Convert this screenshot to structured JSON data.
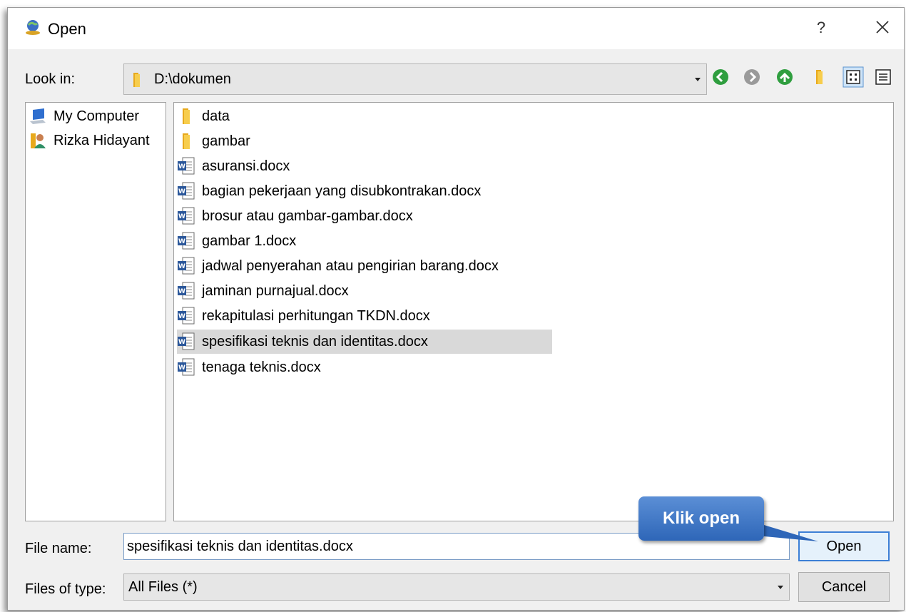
{
  "window": {
    "title": "Open",
    "help_label": "?"
  },
  "look_in": {
    "label": "Look in:",
    "path": "D:\\dokumen"
  },
  "toolbar": [
    "back-icon",
    "forward-icon",
    "up-icon",
    "new-folder-icon",
    "list-view-icon",
    "details-view-icon"
  ],
  "places": [
    {
      "label": "My Computer",
      "icon": "computer-icon"
    },
    {
      "label": "Rizka Hidayant",
      "icon": "user-folder-icon"
    }
  ],
  "files": [
    {
      "name": "data",
      "type": "folder"
    },
    {
      "name": "gambar",
      "type": "folder"
    },
    {
      "name": "asuransi.docx",
      "type": "docx"
    },
    {
      "name": "bagian pekerjaan yang disubkontrakan.docx",
      "type": "docx"
    },
    {
      "name": "brosur atau gambar-gambar.docx",
      "type": "docx"
    },
    {
      "name": "gambar 1.docx",
      "type": "docx"
    },
    {
      "name": "jadwal penyerahan atau pengirian barang.docx",
      "type": "docx"
    },
    {
      "name": "jaminan purnajual.docx",
      "type": "docx"
    },
    {
      "name": "rekapitulasi perhitungan TKDN.docx",
      "type": "docx"
    },
    {
      "name": "spesifikasi teknis dan identitas.docx",
      "type": "docx",
      "selected": true
    },
    {
      "name": "tenaga teknis.docx",
      "type": "docx"
    }
  ],
  "file_name": {
    "label": "File name:",
    "value": "spesifikasi teknis dan identitas.docx"
  },
  "file_type": {
    "label": "Files of type:",
    "value": "All Files (*)"
  },
  "buttons": {
    "open": "Open",
    "cancel": "Cancel"
  },
  "annotation": {
    "text": "Klik open"
  },
  "colors": {
    "accent": "#3c7fd6",
    "callout": "#3a72c4",
    "folder": "#f5c542",
    "word": "#2b579a",
    "selection": "#d9d9d9"
  }
}
